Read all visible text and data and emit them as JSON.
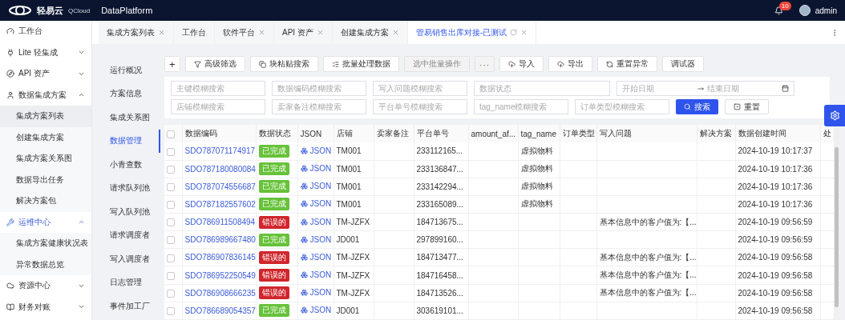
{
  "header": {
    "logo_text": "轻易云",
    "logo_sub": "QCloud",
    "product": "DataPlatform",
    "notifications": "10",
    "user": "admin"
  },
  "sidebar": {
    "items": [
      {
        "label": "工作台",
        "active": false
      },
      {
        "label": "Lite 轻集成",
        "expanded": false,
        "active": false
      },
      {
        "label": "API 资产",
        "expanded": false,
        "active": false
      },
      {
        "label": "数据集成方案",
        "expanded": true,
        "active": false,
        "children": [
          {
            "label": "集成方案列表",
            "selected": true
          },
          {
            "label": "创建集成方案",
            "selected": false
          },
          {
            "label": "集成方案关系图",
            "selected": false
          },
          {
            "label": "数据导出任务",
            "selected": false
          },
          {
            "label": "解决方案包",
            "selected": false
          }
        ]
      },
      {
        "label": "运维中心",
        "expanded": true,
        "active": true,
        "children": [
          {
            "label": "集成方案健康状况表",
            "selected": false
          },
          {
            "label": "异常数据总览",
            "selected": false
          }
        ]
      },
      {
        "label": "资源中心",
        "expanded": false,
        "active": false
      },
      {
        "label": "财务对账",
        "expanded": false,
        "active": false
      }
    ]
  },
  "tabs": [
    {
      "label": "集成方案列表",
      "selected": false,
      "closable": true
    },
    {
      "label": "工作台",
      "selected": false,
      "closable": false
    },
    {
      "label": "软件平台",
      "selected": false,
      "closable": true
    },
    {
      "label": "API 资产",
      "selected": false,
      "closable": true
    },
    {
      "label": "创建集成方案",
      "selected": false,
      "closable": true
    },
    {
      "label": "管易销售出库对接-已测试",
      "selected": true,
      "closable": true
    }
  ],
  "subnav": [
    {
      "label": "运行概况",
      "selected": false
    },
    {
      "label": "方案信息",
      "selected": false
    },
    {
      "label": "集成关系图",
      "selected": false
    },
    {
      "label": "数据管理",
      "selected": true
    },
    {
      "label": "小青查数",
      "selected": false
    },
    {
      "label": "请求队列池",
      "selected": false
    },
    {
      "label": "写入队列池",
      "selected": false
    },
    {
      "label": "请求调度者",
      "selected": false
    },
    {
      "label": "写入调度者",
      "selected": false
    },
    {
      "label": "日志管理",
      "selected": false
    },
    {
      "label": "事件加工厂",
      "selected": false
    }
  ],
  "toolbar": [
    {
      "kind": "add",
      "label": "+",
      "disabled": false
    },
    {
      "kind": "filter",
      "label": "高级筛选",
      "disabled": false
    },
    {
      "kind": "paste",
      "label": "块粘贴搜索",
      "disabled": false
    },
    {
      "kind": "list",
      "label": "批量处理数据",
      "disabled": false
    },
    {
      "kind": "plain",
      "label": "选中批量操作",
      "disabled": true
    },
    {
      "kind": "more",
      "label": "···",
      "disabled": true
    },
    {
      "kind": "upload",
      "label": "导入",
      "disabled": false
    },
    {
      "kind": "upload",
      "label": "导出",
      "disabled": false
    },
    {
      "kind": "reset",
      "label": "重置异常",
      "disabled": false
    },
    {
      "kind": "plain",
      "label": "调试器",
      "disabled": false
    }
  ],
  "filters": {
    "row_1": [
      {
        "kind": "text",
        "placeholder": "主键模糊搜索"
      },
      {
        "kind": "text",
        "placeholder": "数据编码模糊搜索"
      },
      {
        "kind": "text",
        "placeholder": "写入问题模糊搜索"
      },
      {
        "kind": "select",
        "placeholder": "数据状态"
      },
      {
        "kind": "daterange",
        "placeholder": "开始日期",
        "placeholder_end": "结束日期"
      }
    ],
    "row_2": [
      {
        "kind": "text",
        "placeholder": "店铺模糊搜索"
      },
      {
        "kind": "text",
        "placeholder": "卖家备注模糊搜索"
      },
      {
        "kind": "text",
        "placeholder": "平台单号模糊搜索"
      },
      {
        "kind": "text",
        "placeholder": "tag_name模糊搜索"
      },
      {
        "kind": "text",
        "placeholder": "订单类型模糊搜索"
      }
    ],
    "search_button": "搜索",
    "reset_button": "重置"
  },
  "table": {
    "select_all": {
      "checked": false
    },
    "columns": [
      "数据编码",
      "数据状态",
      "JSON",
      "店铺",
      "卖家备注",
      "平台单号",
      "amount_af...",
      "tag_name",
      "订单类型",
      "写入问题",
      "解决方案",
      "数据创建时间",
      "处"
    ],
    "rows": [
      {
        "checked": false,
        "code": "SDO787071174917",
        "status": "已完成",
        "color": "#67c23a",
        "json": "JSON",
        "shop": "TM001",
        "platform_no": "233112165...",
        "tag_name": "虚拟物料",
        "created": "2024-10-19 10:17:37"
      },
      {
        "checked": false,
        "code": "SDO787180080084",
        "status": "已完成",
        "color": "#67c23a",
        "json": "JSON",
        "shop": "TM001",
        "platform_no": "233136847...",
        "tag_name": "虚拟物料",
        "created": "2024-10-19 10:17:36"
      },
      {
        "checked": false,
        "code": "SDO787074556687",
        "status": "已完成",
        "color": "#67c23a",
        "json": "JSON",
        "shop": "TM001",
        "platform_no": "233142294...",
        "tag_name": "虚拟物料",
        "created": "2024-10-19 10:17:36"
      },
      {
        "checked": false,
        "code": "SDO787182557602",
        "status": "已完成",
        "color": "#67c23a",
        "json": "JSON",
        "shop": "TM001",
        "platform_no": "233165089...",
        "tag_name": "虚拟物料",
        "created": "2024-10-19 10:17:36"
      },
      {
        "checked": false,
        "code": "SDO786911508494",
        "status": "错误的",
        "color": "#d0262c",
        "json": "JSON",
        "shop": "TM-JZFX",
        "platform_no": "184713675...",
        "issue": "基本信息中的客户值为:【...",
        "created": "2024-10-19 09:56:59"
      },
      {
        "checked": false,
        "code": "SDO786989667480",
        "status": "已完成",
        "color": "#67c23a",
        "json": "JSON",
        "shop": "JD001",
        "platform_no": "297899160...",
        "created": "2024-10-19 09:56:59"
      },
      {
        "checked": false,
        "code": "SDO786907836145",
        "status": "错误的",
        "color": "#d0262c",
        "json": "JSON",
        "shop": "TM-JZFX",
        "platform_no": "184713477...",
        "issue": "基本信息中的客户值为:【...",
        "created": "2024-10-19 09:56:58"
      },
      {
        "checked": false,
        "code": "SDO786952250549",
        "status": "错误的",
        "color": "#d0262c",
        "json": "JSON",
        "shop": "TM-JZFX",
        "platform_no": "184716458...",
        "issue": "基本信息中的客户值为:【...",
        "created": "2024-10-19 09:56:58"
      },
      {
        "checked": false,
        "code": "SDO786908666235",
        "status": "错误的",
        "color": "#d0262c",
        "json": "JSON",
        "shop": "TM-JZFX",
        "platform_no": "184713526...",
        "issue": "基本信息中的客户值为:【...",
        "created": "2024-10-19 09:56:58"
      },
      {
        "checked": false,
        "code": "SDO786689054357",
        "status": "已完成",
        "color": "#67c23a",
        "json": "JSON",
        "shop": "JD001",
        "platform_no": "303619101...",
        "created": "2024-10-19 09:56:58"
      }
    ]
  }
}
